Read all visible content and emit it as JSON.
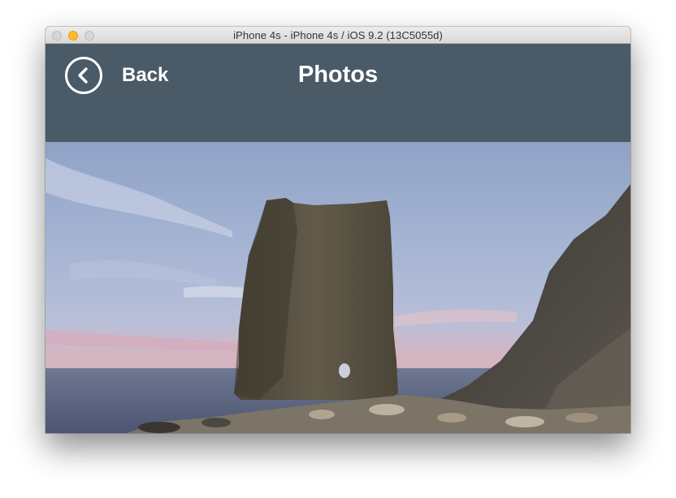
{
  "window": {
    "title": "iPhone 4s - iPhone 4s / iOS 9.2 (13C5055d)"
  },
  "navbar": {
    "back_label": "Back",
    "back_icon": "chevron-left-circle-icon",
    "title": "Photos"
  },
  "photo": {
    "subject": "sea-stack-rock-photo"
  },
  "colors": {
    "navbar": "#4a5a66",
    "nav_text": "#ffffff",
    "traffic_minimize": "#febb2e"
  }
}
